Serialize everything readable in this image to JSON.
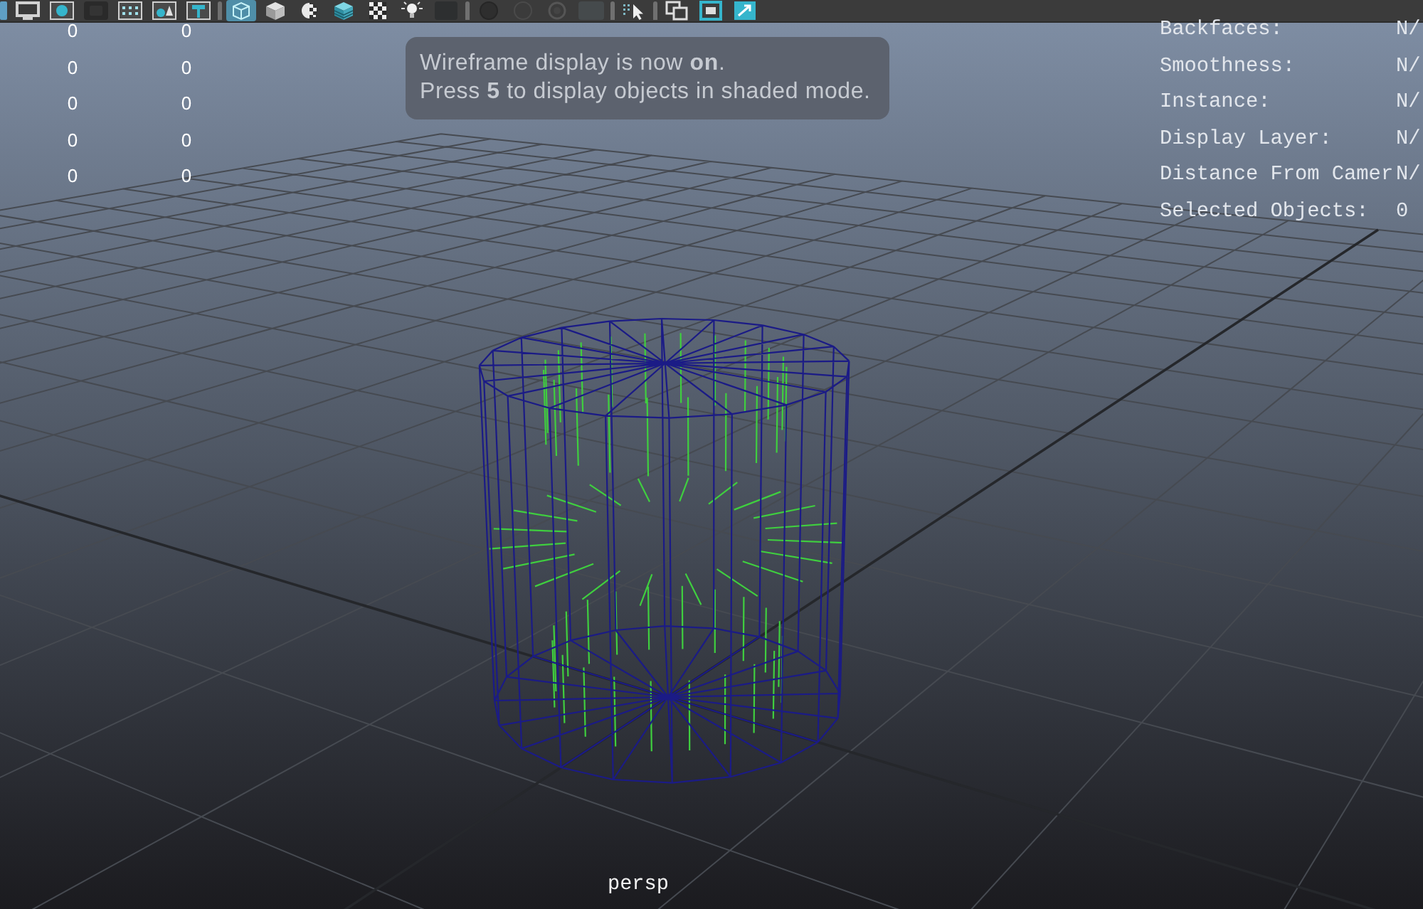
{
  "toolbar": {
    "buttons": [
      {
        "selected": false
      },
      {
        "selected": false
      },
      {
        "selected": false
      },
      {
        "selected": false
      },
      {
        "selected": false
      },
      {
        "selected": false
      },
      {
        "selected": false
      },
      {
        "selected": true
      },
      {
        "selected": false
      },
      {
        "selected": false
      },
      {
        "selected": false
      },
      {
        "selected": false
      },
      {
        "selected": false
      },
      {
        "selected": false
      },
      {
        "selected": false
      },
      {
        "selected": false
      },
      {
        "selected": false
      },
      {
        "selected": false
      },
      {
        "selected": false
      },
      {
        "selected": false
      },
      {
        "selected": false
      },
      {
        "selected": false
      }
    ]
  },
  "poly_count": {
    "rows": [
      {
        "column_1": "0",
        "column_2": "0"
      },
      {
        "column_1": "0",
        "column_2": "0"
      },
      {
        "column_1": "0",
        "column_2": "0"
      },
      {
        "column_1": "0",
        "column_2": "0"
      },
      {
        "column_1": "0",
        "column_2": "0"
      }
    ]
  },
  "message": {
    "lines": [
      "Wireframe display is now **on**.",
      "Press **5** to display objects in shaded mode."
    ]
  },
  "heads_up_display": {
    "rows": [
      {
        "label": "Backfaces:",
        "value": "N/"
      },
      {
        "label": "Smoothness:",
        "value": "N/"
      },
      {
        "label": "Instance:",
        "value": "N/"
      },
      {
        "label": "Display Layer:",
        "value": "N/"
      },
      {
        "label": "Distance From Camer",
        "value": "N/"
      },
      {
        "label": "Selected Objects:",
        "value": "0"
      }
    ]
  },
  "camera_label": "persp"
}
